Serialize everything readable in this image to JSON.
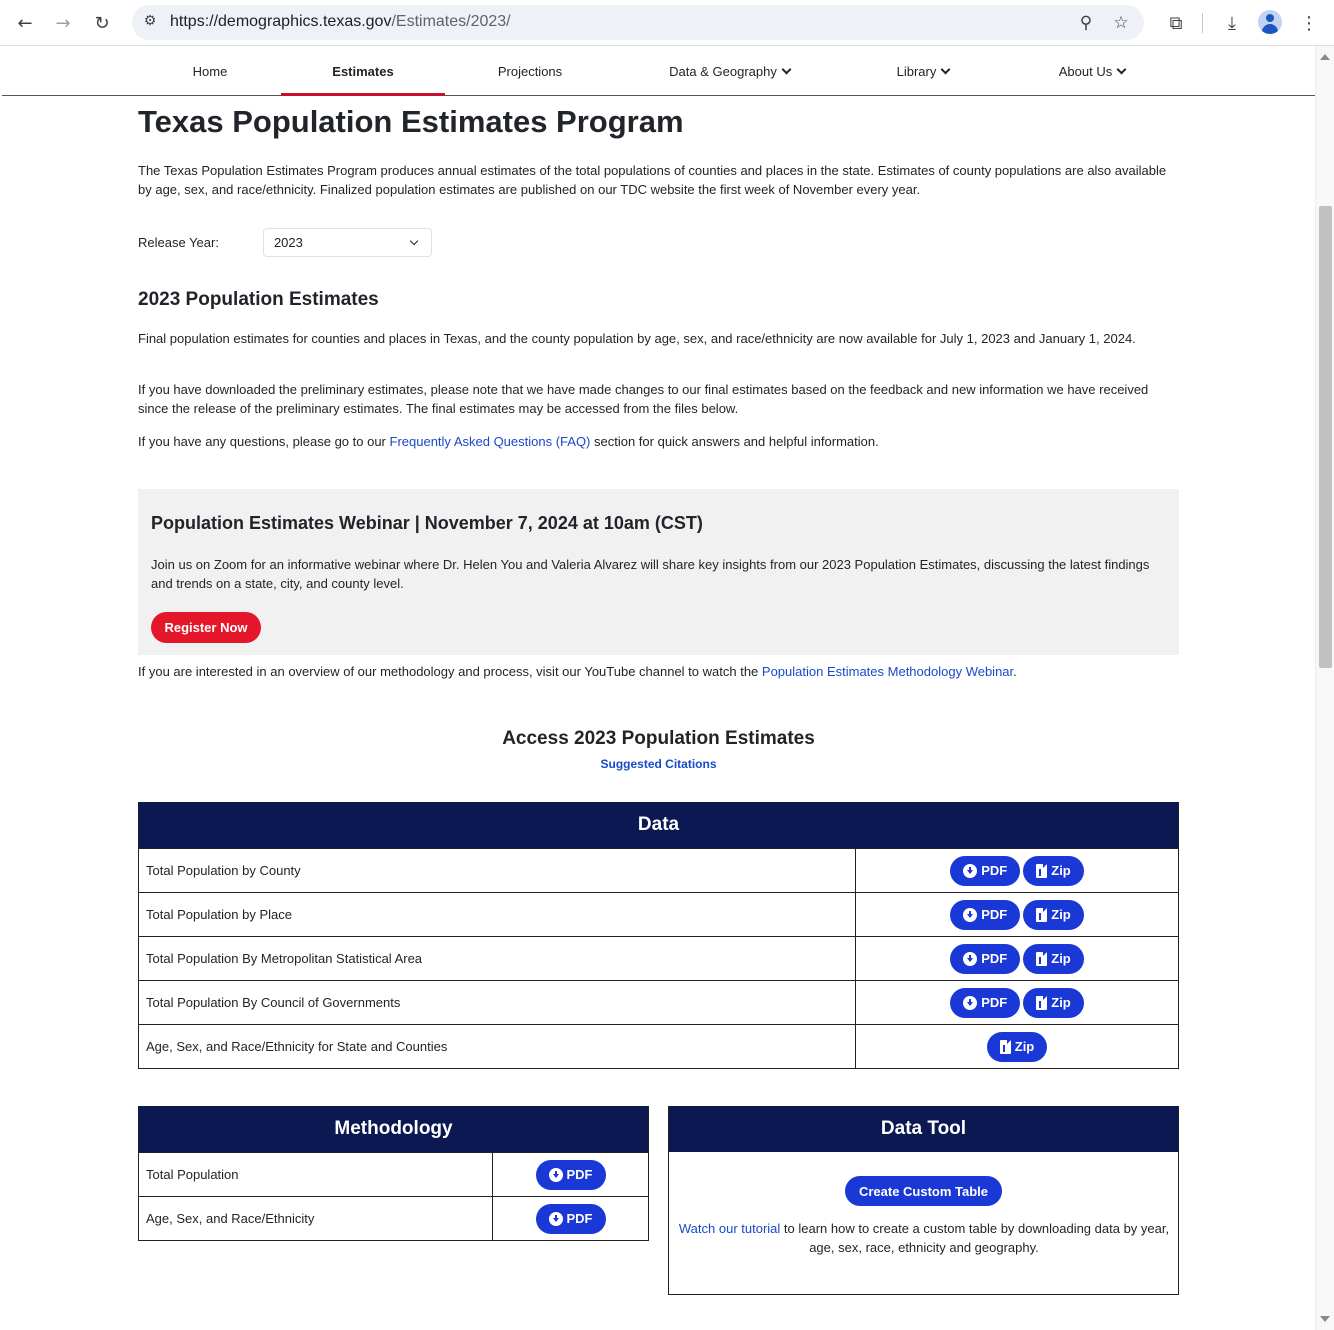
{
  "browser": {
    "url_host": "https://demographics.texas.gov",
    "url_path": "/Estimates/2023/"
  },
  "nav": {
    "items": [
      {
        "label": "Home"
      },
      {
        "label": "Estimates"
      },
      {
        "label": "Projections"
      },
      {
        "label": "Data & Geography"
      },
      {
        "label": "Library"
      },
      {
        "label": "About Us"
      }
    ]
  },
  "page": {
    "title": "Texas Population Estimates Program",
    "intro": "The Texas Population Estimates Program produces annual estimates of the total populations of counties and places in the state. Estimates of county populations are also available by age, sex, and race/ethnicity. Finalized population estimates are published on our TDC website the first week of November every year.",
    "release_label": "Release Year:",
    "release_value": "2023",
    "section_title": "2023 Population Estimates",
    "p1": "Final population estimates for counties and places in Texas, and the county population by age, sex, and race/ethnicity are now available for July 1, 2023 and January 1, 2024.",
    "p2": "If you have downloaded the preliminary estimates, please note that we have made changes to our final estimates based on the feedback and new information we have received since the release of the preliminary estimates. The final estimates may be accessed from the files below.",
    "p3_before": "If you have any questions, please go to our ",
    "p3_link": "Frequently Asked Questions (FAQ)",
    "p3_after": " section for quick answers and helpful information."
  },
  "webinar": {
    "title": "Population Estimates Webinar | November 7, 2024 at 10am (CST)",
    "text": "Join us on Zoom for an informative webinar where Dr. Helen You and Valeria Alvarez will share key insights from our 2023 Population Estimates, discussing the latest findings and trends on a state, city, and county level.",
    "button": "Register Now"
  },
  "youtube": {
    "before": "If you are interested in an overview of our methodology and process, visit our YouTube channel to watch the ",
    "link": "Population Estimates Methodology Webinar",
    "after": "."
  },
  "access": {
    "title": "Access 2023 Population Estimates",
    "citations": "Suggested Citations"
  },
  "data_table": {
    "header": "Data",
    "pdf_label": "PDF",
    "zip_label": "Zip",
    "rows": [
      {
        "label": "Total Population by County"
      },
      {
        "label": "Total Population by Place"
      },
      {
        "label": "Total Population By Metropolitan Statistical Area"
      },
      {
        "label": "Total Population By Council of Governments"
      },
      {
        "label": "Age, Sex, and Race/Ethnicity for State and Counties"
      }
    ]
  },
  "methodology": {
    "header": "Methodology",
    "rows": [
      {
        "label": "Total Population"
      },
      {
        "label": "Age, Sex, and Race/Ethnicity"
      }
    ]
  },
  "data_tool": {
    "header": "Data Tool",
    "button": "Create Custom Table",
    "link": "Watch our tutorial",
    "text": " to learn how to create a custom table by downloading data by year, age, sex, race, ethnicity and geography."
  }
}
